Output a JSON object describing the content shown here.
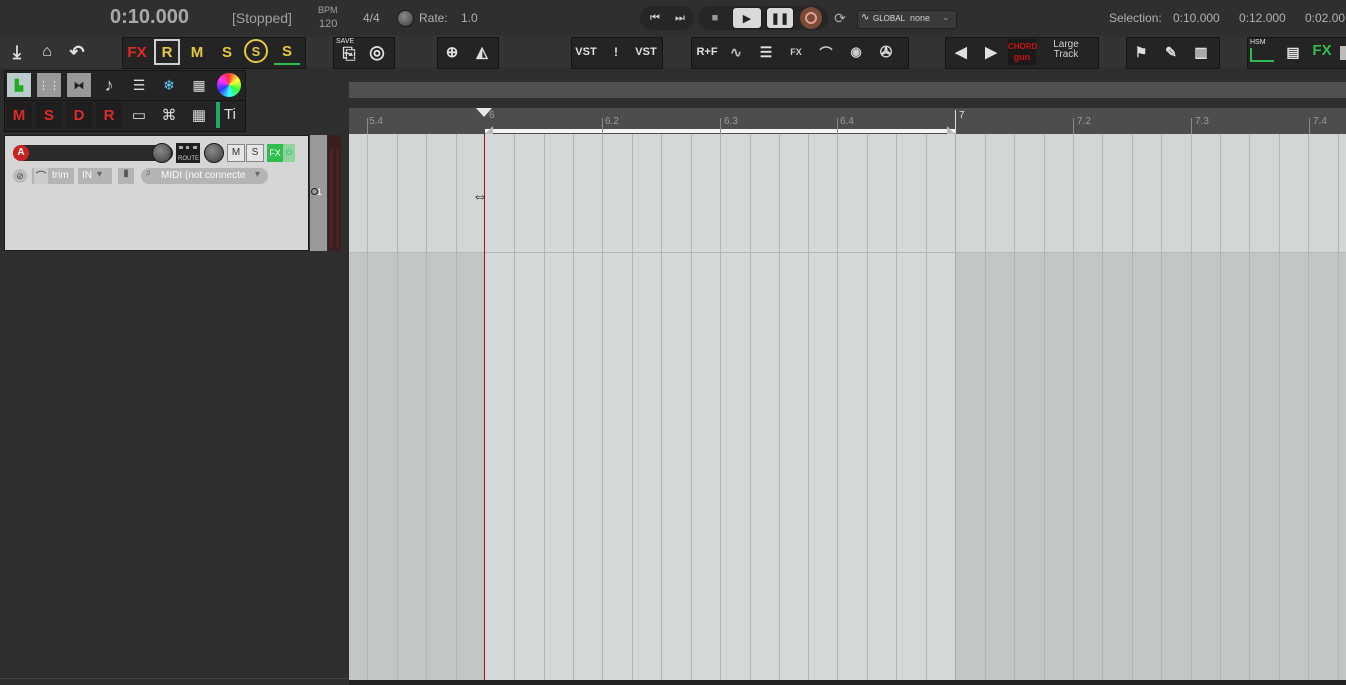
{
  "transport": {
    "time": "0:10.000",
    "status": "[Stopped]",
    "bpm_label": "BPM",
    "bpm_value": "120",
    "time_sig": "4/4",
    "rate_label": "Rate:",
    "rate_value": "1.0",
    "automation_global": "GLOBAL",
    "automation_mode": "none",
    "selection_label": "Selection:",
    "selection_start": "0:10.000",
    "selection_end": "0:12.000",
    "selection_length": "0:02.00"
  },
  "toolbar": {
    "save_label": "SAVE",
    "vst_label": "VST",
    "vst_label2": "VST",
    "exclaim": "!",
    "rf_label": "R+F",
    "fx_label": "FX",
    "chord_label": "CHORD",
    "gun_label": "gun",
    "large_track_label": "Large\nTrack",
    "hsm_label": "HSM",
    "fx_big_label": "FX",
    "fx_label_left": "FX",
    "r_label": "R",
    "m_label": "M",
    "s_label": "S",
    "s_circle_label": "S",
    "s2_label": "S",
    "ti_label": "Ti",
    "tr_m": "M",
    "tr_s": "S",
    "tr_d": "D",
    "tr_r": "R"
  },
  "track": {
    "number": "1",
    "route_label": "ROUTE",
    "mute": "M",
    "solo": "S",
    "fx": "FX",
    "trim": "trim",
    "in": "IN",
    "midi_input": "MIDI (not connecte",
    "rec_letter": "A"
  },
  "ruler": {
    "labels": [
      "5.4",
      "6",
      "6.2",
      "6.3",
      "6.4",
      "7",
      "7.2",
      "7.3",
      "7.4"
    ]
  },
  "colors": {
    "accent_red": "#cc2222",
    "fx_green": "#2fbd4f",
    "chord_red": "#cc1111",
    "selection_bg": "#d3d6d6"
  }
}
